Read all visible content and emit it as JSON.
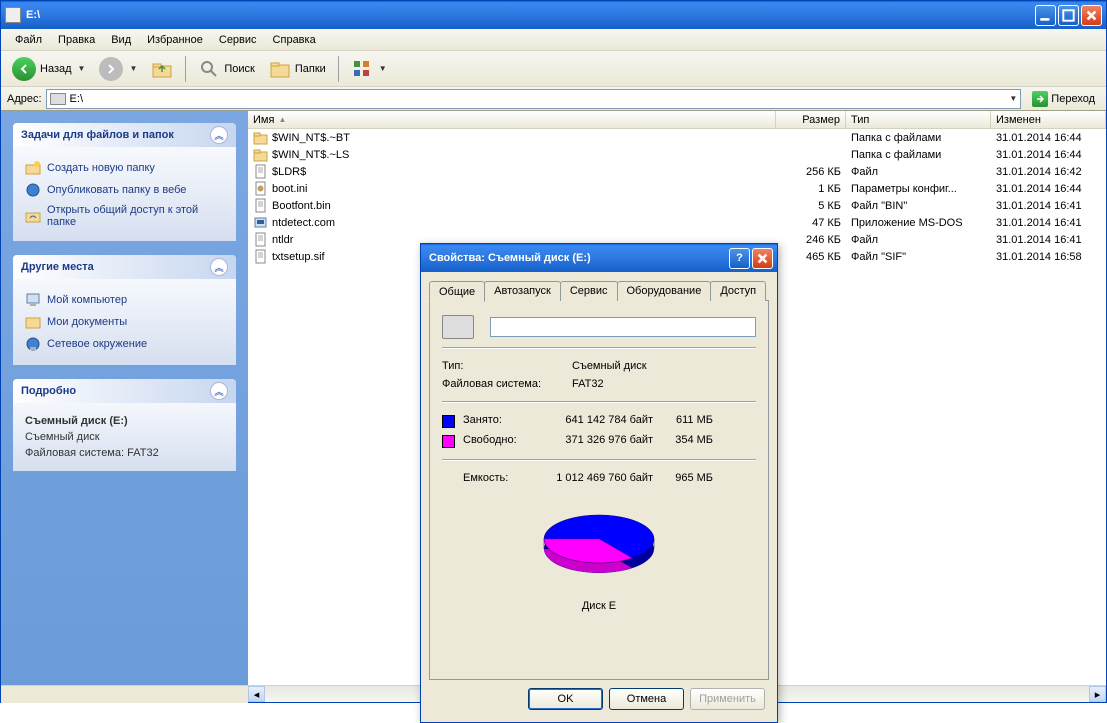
{
  "window": {
    "title": "E:\\"
  },
  "menubar": [
    "Файл",
    "Правка",
    "Вид",
    "Избранное",
    "Сервис",
    "Справка"
  ],
  "toolbar": {
    "back": "Назад",
    "search": "Поиск",
    "folders": "Папки"
  },
  "addressbar": {
    "label": "Адрес:",
    "value": "E:\\",
    "go": "Переход"
  },
  "sidebar": {
    "tasks": {
      "title": "Задачи для файлов и папок",
      "items": [
        "Создать новую папку",
        "Опубликовать папку в вебе",
        "Открыть общий доступ к этой папке"
      ]
    },
    "places": {
      "title": "Другие места",
      "items": [
        "Мой компьютер",
        "Мои документы",
        "Сетевое окружение"
      ]
    },
    "details": {
      "title": "Подробно",
      "name": "Съемный диск (E:)",
      "type": "Съемный диск",
      "fs": "Файловая система: FAT32"
    }
  },
  "columns": {
    "name": "Имя",
    "size": "Размер",
    "type": "Тип",
    "date": "Изменен"
  },
  "files": [
    {
      "name": "$WIN_NT$.~BT",
      "size": "",
      "type": "Папка с файлами",
      "date": "31.01.2014 16:44",
      "icon": "folder"
    },
    {
      "name": "$WIN_NT$.~LS",
      "size": "",
      "type": "Папка с файлами",
      "date": "31.01.2014 16:44",
      "icon": "folder"
    },
    {
      "name": "$LDR$",
      "size": "256 КБ",
      "type": "Файл",
      "date": "31.01.2014 16:42",
      "icon": "file"
    },
    {
      "name": "boot.ini",
      "size": "1 КБ",
      "type": "Параметры конфиг...",
      "date": "31.01.2014 16:44",
      "icon": "ini"
    },
    {
      "name": "Bootfont.bin",
      "size": "5 КБ",
      "type": "Файл \"BIN\"",
      "date": "31.01.2014 16:41",
      "icon": "file"
    },
    {
      "name": "ntdetect.com",
      "size": "47 КБ",
      "type": "Приложение MS-DOS",
      "date": "31.01.2014 16:41",
      "icon": "app"
    },
    {
      "name": "ntldr",
      "size": "246 КБ",
      "type": "Файл",
      "date": "31.01.2014 16:41",
      "icon": "file"
    },
    {
      "name": "txtsetup.sif",
      "size": "465 КБ",
      "type": "Файл \"SIF\"",
      "date": "31.01.2014 16:58",
      "icon": "file"
    }
  ],
  "dialog": {
    "title": "Свойства: Съемный диск (E:)",
    "tabs": [
      "Общие",
      "Автозапуск",
      "Сервис",
      "Оборудование",
      "Доступ"
    ],
    "type_label": "Тип:",
    "type_value": "Съемный диск",
    "fs_label": "Файловая система:",
    "fs_value": "FAT32",
    "used_label": "Занято:",
    "used_bytes": "641 142 784 байт",
    "used_mb": "611 МБ",
    "free_label": "Свободно:",
    "free_bytes": "371 326 976 байт",
    "free_mb": "354 МБ",
    "cap_label": "Емкость:",
    "cap_bytes": "1 012 469 760 байт",
    "cap_mb": "965 МБ",
    "disk_label": "Диск E",
    "ok": "OK",
    "cancel": "Отмена",
    "apply": "Применить"
  },
  "chart_data": {
    "type": "pie",
    "title": "Диск E",
    "series": [
      {
        "name": "Занято",
        "value": 641142784,
        "color": "#0000ff"
      },
      {
        "name": "Свободно",
        "value": 371326976,
        "color": "#ff00ff"
      }
    ]
  }
}
